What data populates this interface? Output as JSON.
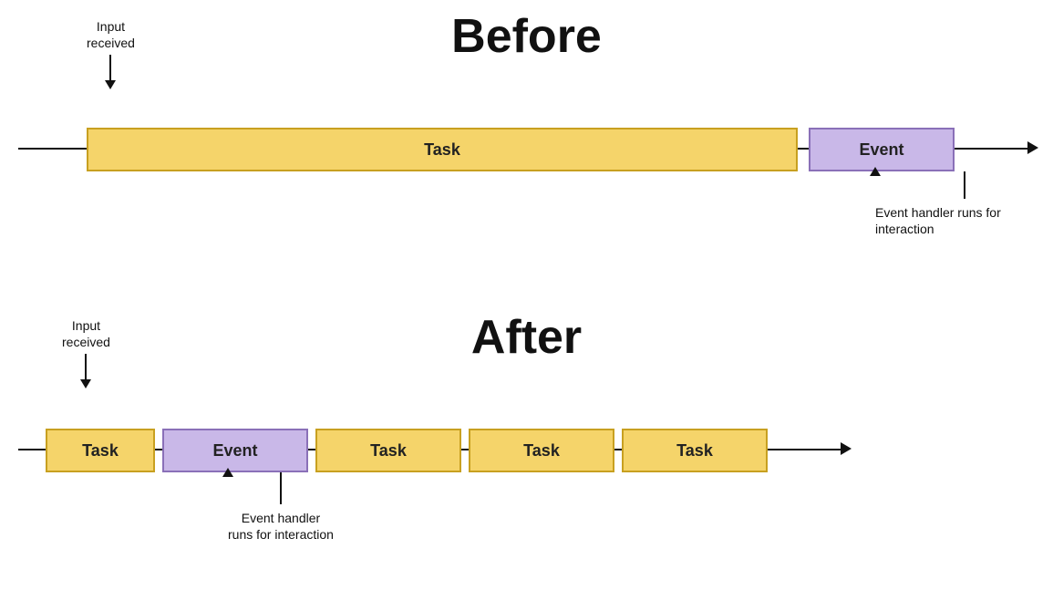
{
  "before": {
    "title": "Before",
    "input_received": "Input\nreceived",
    "event_handler_text": "Event handler\nruns for interaction",
    "task_label": "Task",
    "event_label": "Event"
  },
  "after": {
    "title": "After",
    "input_received": "Input\nreceived",
    "event_handler_text": "Event handler\nruns for interaction",
    "task_label": "Task",
    "event_label": "Event",
    "task2_label": "Task",
    "task3_label": "Task",
    "task4_label": "Task"
  },
  "colors": {
    "task_bg": "#f5d46a",
    "task_border": "#c8a020",
    "event_bg": "#c9b8e8",
    "event_border": "#8a70b8",
    "line": "#111111"
  }
}
